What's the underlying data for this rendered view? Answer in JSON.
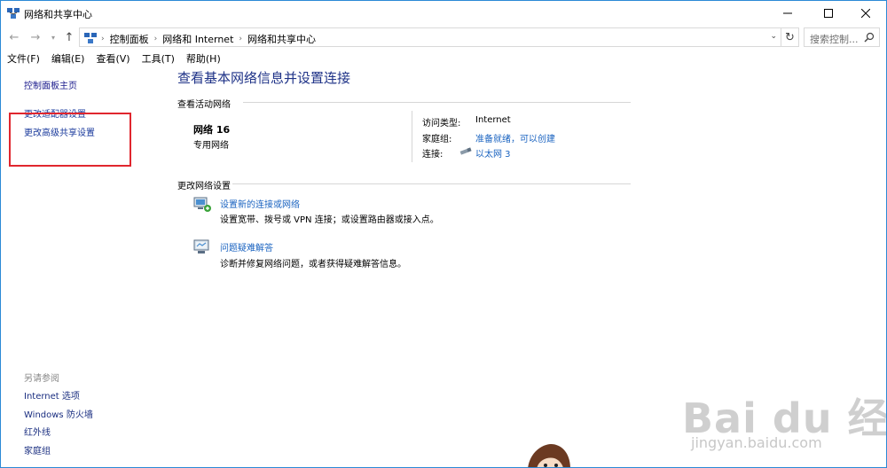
{
  "window": {
    "title": "网络和共享中心",
    "accent": "#2b8ad6"
  },
  "address": {
    "crumbs": [
      "控制面板",
      "网络和 Internet",
      "网络和共享中心"
    ],
    "search_placeholder": "搜索控制..."
  },
  "menu": [
    "文件(F)",
    "编辑(E)",
    "查看(V)",
    "工具(T)",
    "帮助(H)"
  ],
  "sidebar": {
    "home": "控制面板主页",
    "adapter": "更改适配器设置",
    "advanced": "更改高级共享设置",
    "see_also_title": "另请参阅",
    "see_also": [
      "Internet 选项",
      "Windows 防火墙",
      "红外线",
      "家庭组"
    ]
  },
  "main": {
    "title": "查看基本网络信息并设置连接",
    "active_section": "查看活动网络",
    "network_name": "网络  16",
    "network_type": "专用网络",
    "props": {
      "access_label": "访问类型:",
      "access_value": "Internet",
      "homegroup_label": "家庭组:",
      "homegroup_value": "准备就绪，可以创建",
      "connection_label": "连接:",
      "connection_value": "以太网 3"
    },
    "change_section": "更改网络设置",
    "tasks": [
      {
        "label": "设置新的连接或网络",
        "desc": "设置宽带、拨号或 VPN 连接；或设置路由器或接入点。"
      },
      {
        "label": "问题疑难解答",
        "desc": "诊断并修复网络问题，或者获得疑难解答信息。"
      }
    ]
  },
  "watermark": {
    "brand": "Bai du 经验",
    "url": "jingyan.baidu.com"
  },
  "colors": {
    "link": "#1a63c0",
    "title": "#1e3287",
    "highlight": "#e0262e"
  }
}
